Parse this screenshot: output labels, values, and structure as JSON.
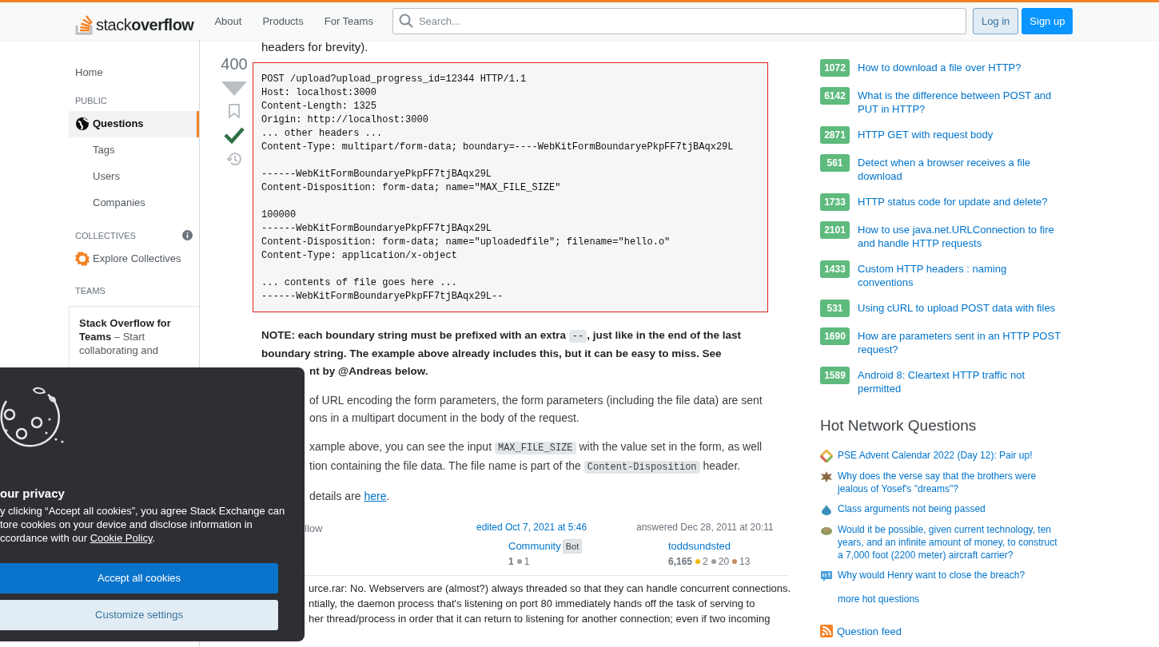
{
  "header": {
    "logo": {
      "light": "stack",
      "bold": "overflow"
    },
    "nav": [
      "About",
      "Products",
      "For Teams"
    ],
    "search": {
      "placeholder": "Search..."
    },
    "login": "Log in",
    "signup": "Sign up"
  },
  "sidebar": {
    "home": "Home",
    "sections": [
      {
        "title": "PUBLIC",
        "items": [
          {
            "label": "Questions",
            "selected": true
          },
          {
            "label": "Tags",
            "selected": false
          },
          {
            "label": "Users",
            "selected": false
          },
          {
            "label": "Companies",
            "selected": false
          }
        ]
      },
      {
        "title": "COLLECTIVES",
        "items": [
          {
            "label": "Explore Collectives",
            "selected": false
          }
        ]
      },
      {
        "title": "TEAMS"
      }
    ],
    "teams_card": {
      "title": "Stack Overflow for Teams",
      "text": " – Start collaborating and"
    }
  },
  "post": {
    "intro": "headers for brevity).",
    "score": "400",
    "accepted": true,
    "code": "POST /upload?upload_progress_id=12344 HTTP/1.1\nHost: localhost:3000\nContent-Length: 1325\nOrigin: http://localhost:3000\n... other headers ...\nContent-Type: multipart/form-data; boundary=----WebKitFormBoundaryePkpFF7tjBAqx29L\n\n------WebKitFormBoundaryePkpFF7tjBAqx29L\nContent-Disposition: form-data; name=\"MAX_FILE_SIZE\"\n\n100000\n------WebKitFormBoundaryePkpFF7tjBAqx29L\nContent-Disposition: form-data; name=\"uploadedfile\"; filename=\"hello.o\"\nContent-Type: application/x-object\n\n... contents of file goes here ...\n------WebKitFormBoundaryePkpFF7tjBAqx29L--",
    "paragraphs": [
      {
        "bold": true,
        "lines": [
          {
            "kind": "full",
            "parts": [
              {
                "kind": "text",
                "text": "NOTE: each boundary string must be prefixed with an extra "
              },
              {
                "kind": "code",
                "text": "--"
              },
              {
                "kind": "text",
                "text": ", just like in the end of the last"
              }
            ]
          },
          {
            "kind": "full",
            "parts": [
              {
                "kind": "text",
                "text": "boundary string. The example above already includes this, but it can be easy to miss. See"
              }
            ]
          },
          {
            "kind": "covered",
            "parts": [
              {
                "kind": "text",
                "text": "nt by @Andreas below."
              }
            ]
          }
        ]
      },
      {
        "bold": false,
        "lines": [
          {
            "kind": "covered",
            "parts": [
              {
                "kind": "text",
                "text": "of URL encoding the form parameters, the form parameters (including the file data) are sent"
              }
            ]
          },
          {
            "kind": "covered",
            "parts": [
              {
                "kind": "text",
                "text": "ons in a multipart document in the body of the request."
              }
            ]
          }
        ]
      },
      {
        "bold": false,
        "lines": [
          {
            "kind": "covered",
            "parts": [
              {
                "kind": "text",
                "text": "xample above, you can see the input "
              },
              {
                "kind": "code",
                "text": "MAX_FILE_SIZE"
              },
              {
                "kind": "text",
                "text": " with the value set in the form, as well"
              }
            ]
          },
          {
            "kind": "covered",
            "parts": [
              {
                "kind": "text",
                "text": "tion containing the file data. The file name is part of the "
              },
              {
                "kind": "code",
                "text": "Content-Disposition"
              },
              {
                "kind": "text",
                "text": " header."
              }
            ]
          }
        ]
      },
      {
        "bold": false,
        "lines": [
          {
            "kind": "covered",
            "parts": [
              {
                "kind": "text",
                "text": "details are "
              },
              {
                "kind": "link",
                "text": "here"
              },
              {
                "kind": "text",
                "text": "."
              }
            ]
          }
        ]
      }
    ],
    "follow": "llow",
    "edited": {
      "label": "edited Oct 7, 2021 at 5:46",
      "user": "Community",
      "badge": "Bot",
      "rep": "1",
      "badges": [
        {
          "color": "#9a9fa5",
          "count": "1"
        }
      ]
    },
    "answered": {
      "label": "answered Dec 28, 2011 at 20:11",
      "user": "toddsundsted",
      "rep": "6,165",
      "badges": [
        {
          "color": "#f1b600",
          "count": "2"
        },
        {
          "color": "#9a9fa5",
          "count": "20"
        },
        {
          "color": "#c38b5f",
          "count": "13"
        }
      ]
    },
    "comment": [
      "urce.rar: No. Webservers are (almost?) always threaded so that they can handle concurrent connections.",
      "ntially, the daemon process that's listening on port 80 immediately hands off the task of serving to",
      "her thread/process in order that it can return to listening for another connection; even if two incoming"
    ]
  },
  "linked": [
    {
      "score": "1072",
      "title": "How to download a file over HTTP?"
    },
    {
      "score": "6142",
      "title": "What is the difference between POST and PUT in HTTP?"
    },
    {
      "score": "2871",
      "title": "HTTP GET with request body"
    },
    {
      "score": "561",
      "title": "Detect when a browser receives a file download"
    },
    {
      "score": "1733",
      "title": "HTTP status code for update and delete?"
    },
    {
      "score": "2101",
      "title": "How to use java.net.URLConnection to fire and handle HTTP requests"
    },
    {
      "score": "1433",
      "title": "Custom HTTP headers : naming conventions"
    },
    {
      "score": "531",
      "title": "Using cURL to upload POST data with files"
    },
    {
      "score": "1690",
      "title": "How are parameters sent in an HTTP POST request?"
    },
    {
      "score": "1589",
      "title": "Android 8: Cleartext HTTP traffic not permitted"
    }
  ],
  "hot": {
    "title": "Hot Network Questions",
    "items": [
      "PSE Advent Calendar 2022 (Day 12): Pair up!",
      "Why does the verse say that the brothers were jealous of Yosef's \"dreams\"?",
      "Class arguments not being passed",
      "Would it be possible, given current technology, ten years, and an infinite amount of money, to construct a 7,000 foot (2200 meter) aircraft carrier?",
      "Why would Henry want to close the breach?"
    ],
    "more": "more hot questions"
  },
  "feed": "Question feed",
  "cookie": {
    "title": "our privacy",
    "lines": [
      {
        "text": "y clicking “Accept all cookies”, you agree Stack Exchange can"
      },
      {
        "text": "tore cookies on your device and disclose information in"
      },
      {
        "text": "ccordance with our ",
        "link": "Cookie Policy",
        "after": "."
      }
    ],
    "accept": "Accept all cookies",
    "customize": "Customize settings"
  }
}
